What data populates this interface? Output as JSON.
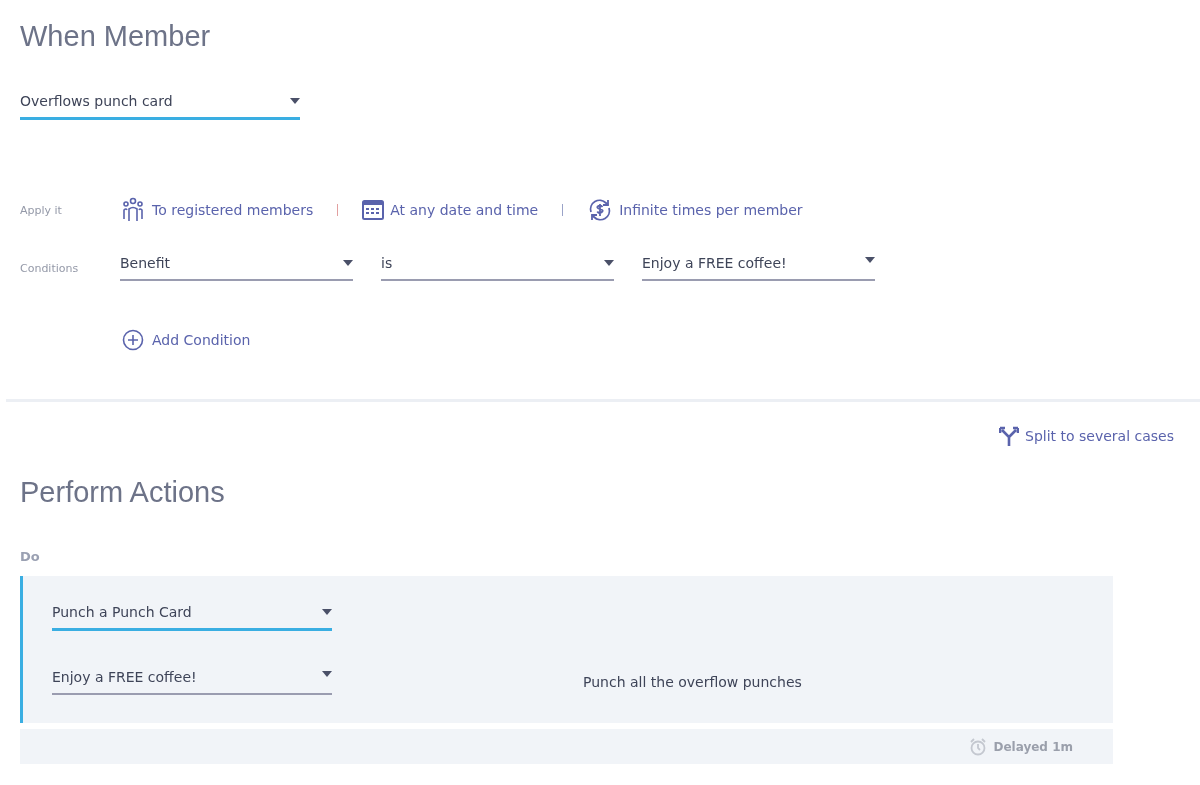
{
  "trigger": {
    "title": "When Member",
    "event": {
      "value": "Overflows punch card",
      "focused": true
    }
  },
  "apply": {
    "label": "Apply it",
    "options": [
      {
        "kind": "members",
        "text": "To registered members"
      },
      {
        "kind": "calendar",
        "text": "At any date and time"
      },
      {
        "kind": "recurring",
        "text": "Infinite times per member"
      }
    ]
  },
  "conditions": {
    "label": "Conditions",
    "fields": [
      {
        "value": "Benefit",
        "focused": false
      },
      {
        "value": "is",
        "focused": false
      },
      {
        "value": "Enjoy a FREE coffee!",
        "focused": false
      }
    ],
    "add_button": "Add Condition"
  },
  "split_button": "Split to several cases",
  "actions": {
    "title": "Perform Actions",
    "do_label": "Do",
    "action_type": {
      "value": "Punch a Punch Card",
      "focused": true
    },
    "benefit": {
      "value": "Enjoy a FREE coffee!",
      "focused": false
    },
    "description": "Punch all the overflow punches",
    "delay": "Delayed 1m"
  }
}
